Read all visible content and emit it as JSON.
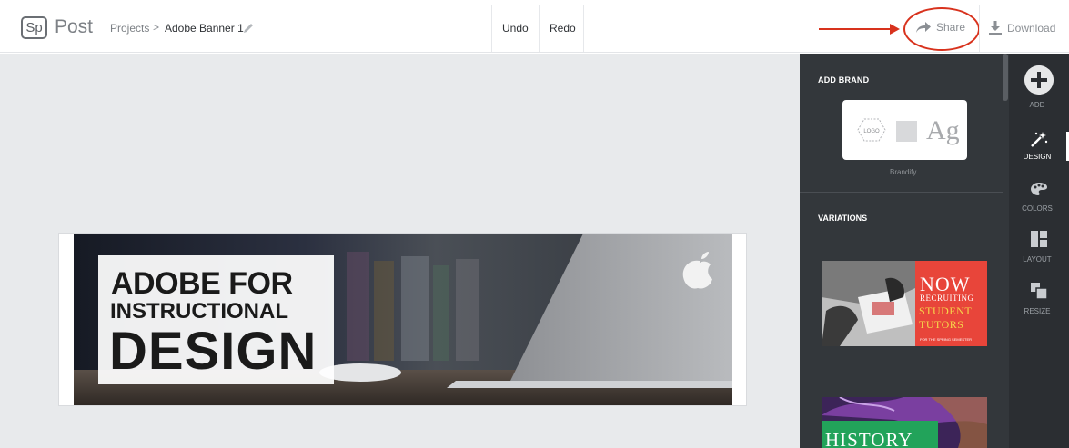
{
  "topbar": {
    "logo": "Sp",
    "app_name": "Post",
    "breadcrumb": {
      "projects": "Projects",
      "separator": ">",
      "current": "Adobe Banner 1"
    },
    "undo": "Undo",
    "redo": "Redo",
    "share": "Share",
    "download": "Download"
  },
  "banner": {
    "line1": "ADOBE FOR",
    "line2": "INSTRUCTIONAL",
    "line3": "DESIGN"
  },
  "panel": {
    "add_brand": "ADD BRAND",
    "brand_card": {
      "logo": "LOGO",
      "ag": "Ag"
    },
    "brandify": "Brandify",
    "variations": "VARIATIONS",
    "variation1": {
      "now": "NOW",
      "line2": "RECRUITING",
      "line3": "STUDENT",
      "line4": "TUTORS",
      "small": "FOR THE SPRING SEMESTER"
    },
    "variation2": {
      "title": "HISTORY"
    }
  },
  "rail": {
    "items": [
      {
        "label": "ADD",
        "icon": "plus-circle-icon"
      },
      {
        "label": "DESIGN",
        "icon": "magic-wand-icon",
        "active": true
      },
      {
        "label": "COLORS",
        "icon": "palette-icon"
      },
      {
        "label": "LAYOUT",
        "icon": "layout-icon"
      },
      {
        "label": "RESIZE",
        "icon": "resize-icon"
      }
    ]
  },
  "colors": {
    "annotation_red": "#d8321d",
    "panel_bg": "#33373b",
    "rail_bg": "#2b2e32",
    "canvas_bg": "#e8eaec"
  }
}
